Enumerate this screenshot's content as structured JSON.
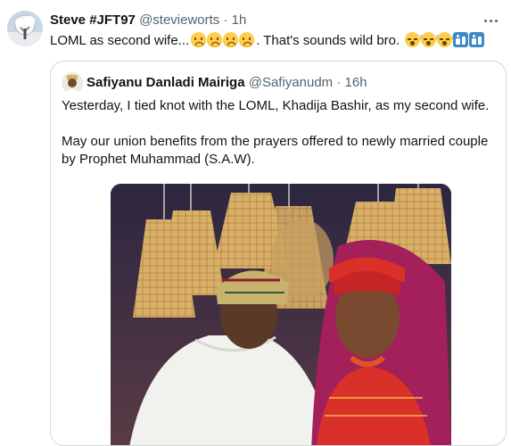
{
  "tweet": {
    "author_name": "Steve #JFT97",
    "handle": "@stevieworts",
    "separator": "·",
    "time": "1h",
    "text_part1": "LOML as second wife...",
    "text_part2": ". That's sounds wild bro.",
    "avatar_icon": "tree-avatar",
    "emojis_sad": [
      "frowning-face",
      "frowning-face",
      "frowning-face",
      "frowning-face"
    ],
    "emojis_tail": [
      "sleeping-face",
      "sleeping-face",
      "sleeping-face",
      "restroom-icon",
      "restroom-icon"
    ]
  },
  "quoted_tweet": {
    "author_name": "Safiyanu Danladi Mairiga",
    "handle": "@Safiyanudm",
    "separator": "·",
    "time": "16h",
    "paragraph1": "Yesterday, I tied knot with the LOML, Khadija Bashir, as my second wife.",
    "paragraph2": "May our union benefits from the prayers offered to newly married couple by Prophet Muhammad (S.A.W).",
    "avatar_icon": "man-in-cap-avatar",
    "media": "wedding-photo"
  },
  "colors": {
    "text_primary": "#0f1419",
    "text_secondary": "#536471",
    "border": "#cfd9de",
    "bride_red": "#d9302a",
    "bride_veil": "#a3205a"
  }
}
